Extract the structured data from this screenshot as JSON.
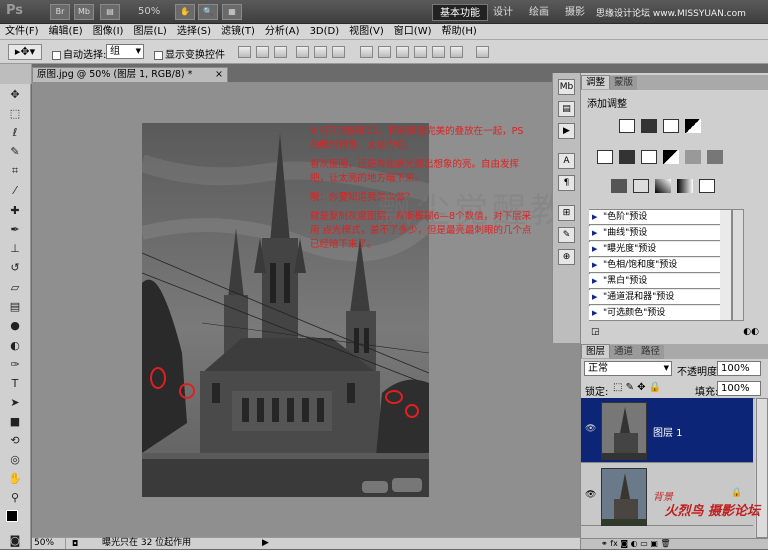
{
  "app": {
    "logo": "Ps",
    "buttons": [
      "Br",
      "Mb"
    ],
    "zoom": "50%"
  },
  "workspaces": [
    "基本功能",
    "设计",
    "绘画",
    "摄影"
  ],
  "site_mark": "思缘设计论坛 www.MISSYUAN.com",
  "menu": [
    "文件(F)",
    "编辑(E)",
    "图像(I)",
    "图层(L)",
    "选择(S)",
    "滤镜(T)",
    "分析(A)",
    "3D(D)",
    "视图(V)",
    "窗口(W)",
    "帮助(H)"
  ],
  "options": {
    "auto_select_label": "自动选择:",
    "auto_select_value": "组",
    "show_transform_label": "显示变换控件"
  },
  "document": {
    "tab_title": "原图.jpg @ 50% (图层 1, RGB/8) *",
    "close": "×",
    "annotation": [
      "9.打开原图和03，将两张图完美的叠放在一起，PS的吸附特性，太省力啦。",
      "看灰度图，还是有些高光超出想象的亮。自由发挥吧，让太亮的地方暗下来。",
      "哦：你要知道我怎么做？",
      "就是复制灰度图层，高斯模糊6—8个数值，对下层采用 点光模式，盖不了多少，但是最亮最刺眼的几个点已经暗下来了。"
    ],
    "watermark": "飘尘觉醒教程"
  },
  "status": {
    "zoom": "50%",
    "message": "曝光只在 32 位起作用"
  },
  "adjustments": {
    "tabs": [
      "调整",
      "蒙版"
    ],
    "title": "添加调整",
    "presets": [
      "\"色阶\"预设",
      "\"曲线\"预设",
      "\"曝光度\"预设",
      "\"色相/饱和度\"预设",
      "\"黑白\"预设",
      "\"通道混和器\"预设",
      "\"可选颜色\"预设"
    ]
  },
  "layers_panel": {
    "tabs": [
      "图层",
      "通道",
      "路径"
    ],
    "blend_mode": "正常",
    "opacity_label": "不透明度:",
    "opacity_value": "100%",
    "lock_label": "锁定:",
    "fill_label": "填充:",
    "fill_value": "100%",
    "layers": [
      {
        "name": "图层 1",
        "selected": true
      },
      {
        "name": "背景",
        "selected": false
      }
    ],
    "footer_logo": "火烈鸟 摄影论坛"
  },
  "colors": {
    "selection": "#0c2577",
    "annotation": "#e02020",
    "app_bar": "#3e3e3e"
  }
}
